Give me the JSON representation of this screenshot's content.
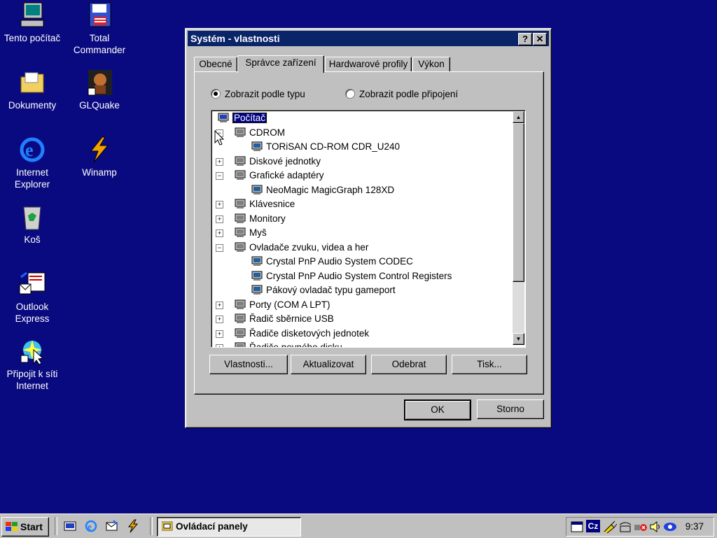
{
  "desktop": {
    "icons": [
      {
        "label": "Tento počítač"
      },
      {
        "label": "Total Commander"
      },
      {
        "label": "Dokumenty"
      },
      {
        "label": "GLQuake"
      },
      {
        "label": "Internet Explorer"
      },
      {
        "label": "Winamp"
      },
      {
        "label": "Koš"
      },
      {
        "label": "Outlook Express"
      },
      {
        "label": "Připojit k síti Internet"
      }
    ]
  },
  "window": {
    "title": "Systém - vlastnosti",
    "help_btn": "?",
    "close_btn": "✕",
    "tabs": [
      {
        "label": "Obecné"
      },
      {
        "label": "Správce zařízení"
      },
      {
        "label": "Hardwarové profily"
      },
      {
        "label": "Výkon"
      }
    ],
    "radio_by_type": "Zobrazit podle typu",
    "radio_by_connection": "Zobrazit podle připojení",
    "tree": [
      {
        "label": "Počítač",
        "level": 0
      },
      {
        "label": "CDROM",
        "level": 1,
        "expand": "−"
      },
      {
        "label": "TORiSAN CD-ROM CDR_U240",
        "level": 2
      },
      {
        "label": "Diskové jednotky",
        "level": 1,
        "expand": "+"
      },
      {
        "label": "Grafické adaptéry",
        "level": 1,
        "expand": "−"
      },
      {
        "label": "NeoMagic MagicGraph 128XD",
        "level": 2
      },
      {
        "label": "Klávesnice",
        "level": 1,
        "expand": "+"
      },
      {
        "label": "Monitory",
        "level": 1,
        "expand": "+"
      },
      {
        "label": "Myš",
        "level": 1,
        "expand": "+"
      },
      {
        "label": "Ovladače zvuku, videa a her",
        "level": 1,
        "expand": "−"
      },
      {
        "label": "Crystal PnP Audio System CODEC",
        "level": 2
      },
      {
        "label": "Crystal PnP Audio System Control Registers",
        "level": 2
      },
      {
        "label": "Pákový ovladač typu gameport",
        "level": 2
      },
      {
        "label": "Porty (COM A LPT)",
        "level": 1,
        "expand": "+"
      },
      {
        "label": "Řadič sběrnice USB",
        "level": 1,
        "expand": "+"
      },
      {
        "label": "Řadiče disketových jednotek",
        "level": 1,
        "expand": "+"
      },
      {
        "label": "Řadiče pevného disku",
        "level": 1,
        "expand": "+"
      }
    ],
    "buttons": {
      "properties": "Vlastnosti...",
      "refresh": "Aktualizovat",
      "remove": "Odebrat",
      "print": "Tisk...",
      "ok": "OK",
      "cancel": "Storno"
    }
  },
  "taskbar": {
    "start": "Start",
    "task": "Ovládací panely",
    "tray_lang": "Cz",
    "clock": "9:37"
  }
}
